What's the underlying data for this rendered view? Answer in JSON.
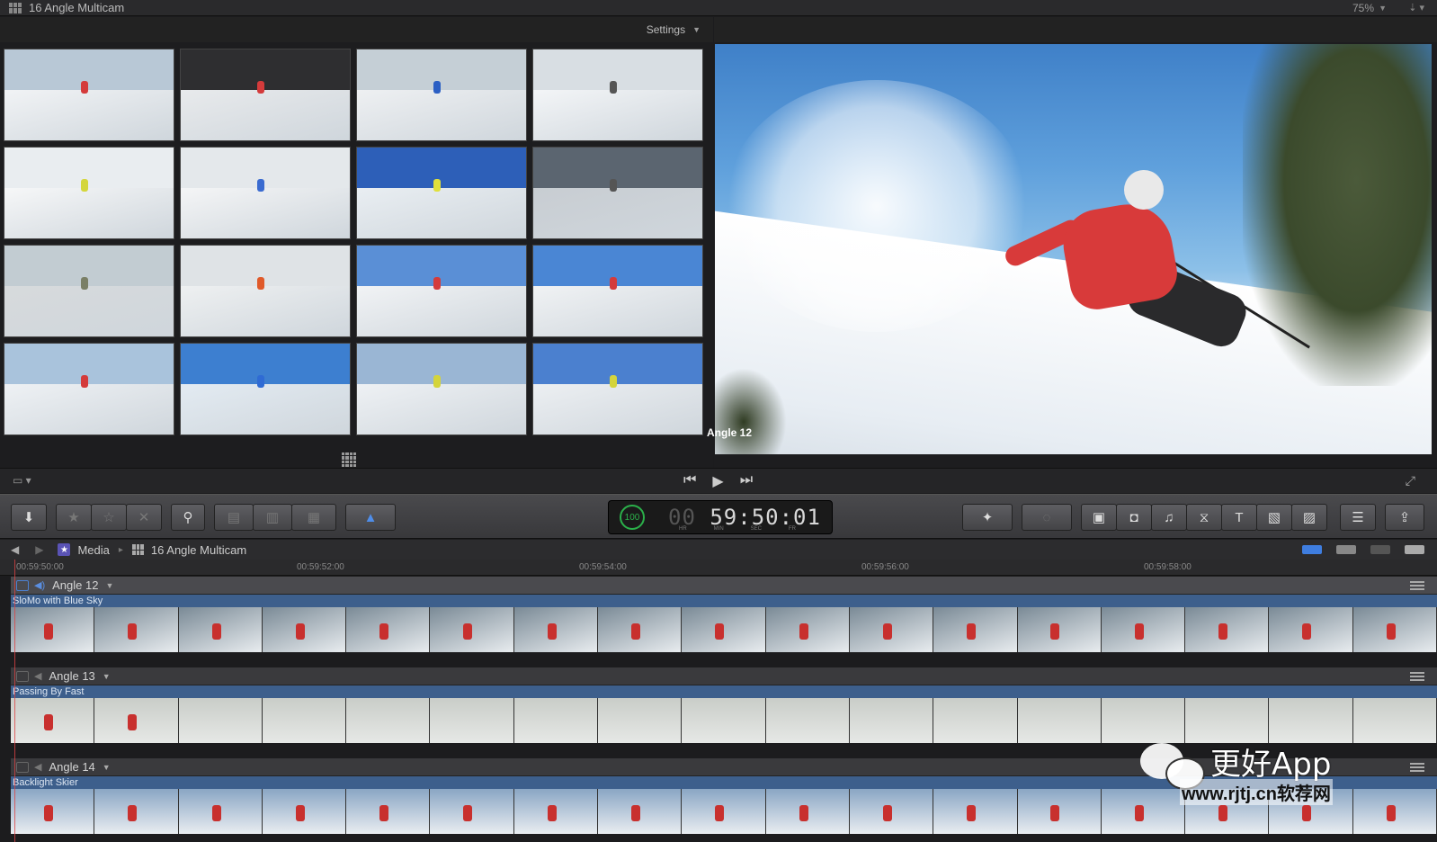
{
  "window": {
    "title": "16 Angle Multicam",
    "zoom": "75%"
  },
  "angle_viewer": {
    "settings_label": "Settings",
    "angles": [
      {
        "sky": "#b8c8d6",
        "snow": "#f1f3f5",
        "skier": "#d43b3b"
      },
      {
        "sky": "#2e2e30",
        "snow": "#e8eaec",
        "skier": "#d43b3b"
      },
      {
        "sky": "#c5cfd6",
        "snow": "#eef0f2",
        "skier": "#2b5fc4"
      },
      {
        "sky": "#d8dee3",
        "snow": "#f3f5f7",
        "skier": "#555555"
      },
      {
        "sky": "#e9edf0",
        "snow": "#f6f7f8",
        "skier": "#d4d63b"
      },
      {
        "sky": "#e4e8eb",
        "snow": "#f4f5f6",
        "skier": "#3a6bd0"
      },
      {
        "sky": "#2d5fb8",
        "snow": "#e9eef2",
        "skier": "#e0e03a"
      },
      {
        "sky": "#5b6570",
        "snow": "#c8cdd2",
        "skier": "#555555"
      },
      {
        "sky": "#c2ccd2",
        "snow": "#d7dadc",
        "skier": "#7a7f66"
      },
      {
        "sky": "#dfe3e6",
        "snow": "#eef0f1",
        "skier": "#e05a2a"
      },
      {
        "sky": "#5a8fd6",
        "snow": "#f1f3f5",
        "skier": "#d43b3b"
      },
      {
        "sky": "#4a86d4",
        "snow": "#f0f2f4",
        "skier": "#d43b3b"
      },
      {
        "sky": "#a9c3dc",
        "snow": "#eef1f4",
        "skier": "#d43b3b"
      },
      {
        "sky": "#3d7fd0",
        "snow": "#e3ebf2",
        "skier": "#2f6bd4"
      },
      {
        "sky": "#9ab6d4",
        "snow": "#eef1f4",
        "skier": "#d4d43b"
      },
      {
        "sky": "#4b80cf",
        "snow": "#eceff2",
        "skier": "#d4d43b"
      }
    ]
  },
  "viewer": {
    "angle_label": "Angle 12"
  },
  "transport": {
    "prev": "⏮",
    "play": "▶",
    "next": "⏭",
    "fullscreen": "⤢"
  },
  "toolbar": {
    "import": "⬇",
    "rating_favorite": "★",
    "rating_unrated": "☆",
    "rating_reject": "✕",
    "keyword": "⚲",
    "edit_connect": "▤",
    "edit_insert": "▥",
    "edit_append": "▦",
    "select_tool": "▲",
    "enhance": "✦",
    "retime": "◌",
    "browser_clips": "▣",
    "photos": "◘",
    "music": "♫",
    "transitions": "⧖",
    "titles": "T",
    "generators": "▧",
    "themes": "▨",
    "inspector": "☰",
    "share": "⇪",
    "timecode": "59:50:01",
    "timecode_prefix": "00",
    "timecode_speed": "100",
    "timecode_units": [
      "HR",
      "MIN",
      "SEC",
      "FR"
    ]
  },
  "timeline": {
    "breadcrumb": [
      "Media",
      "16 Angle Multicam"
    ],
    "ruler": [
      "00:59:50:00",
      "00:59:52:00",
      "00:59:54:00",
      "00:59:56:00",
      "00:59:58:00"
    ],
    "lanes": [
      {
        "angle": "Angle 12",
        "clip": "SloMo with Blue Sky",
        "active": true
      },
      {
        "angle": "Angle 13",
        "clip": "Passing By Fast",
        "active": false
      },
      {
        "angle": "Angle 14",
        "clip": "Backlight Skier",
        "active": false
      }
    ]
  },
  "watermark": {
    "brand": "更好App",
    "url": "www.rjtj.cn软荐网"
  }
}
